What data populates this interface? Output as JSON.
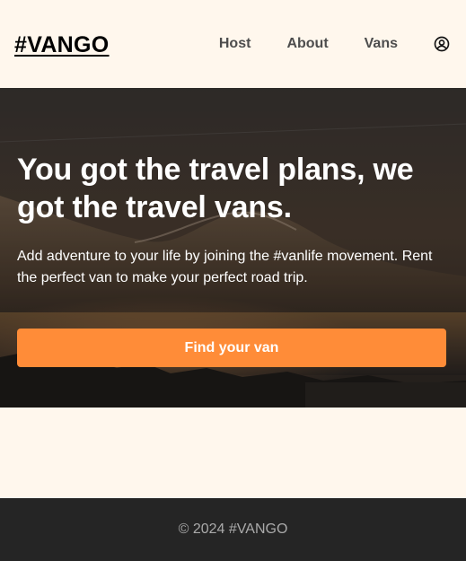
{
  "header": {
    "logo": "#VANGO",
    "nav": {
      "host": "Host",
      "about": "About",
      "vans": "Vans"
    },
    "login_icon": "user-circle-icon"
  },
  "hero": {
    "title": "You got the travel plans, we got the travel vans.",
    "text": "Add adventure to your life by joining the #vanlife movement. Rent the perfect van to make your perfect road trip.",
    "cta_label": "Find your van",
    "background": "mountain-lake-photo"
  },
  "footer": {
    "text": "© 2024 #VANGO"
  },
  "colors": {
    "page_bg": "#FFF7ED",
    "accent": "#FF8C38",
    "footer_bg": "#252525",
    "nav_text": "#4D4D4D"
  }
}
